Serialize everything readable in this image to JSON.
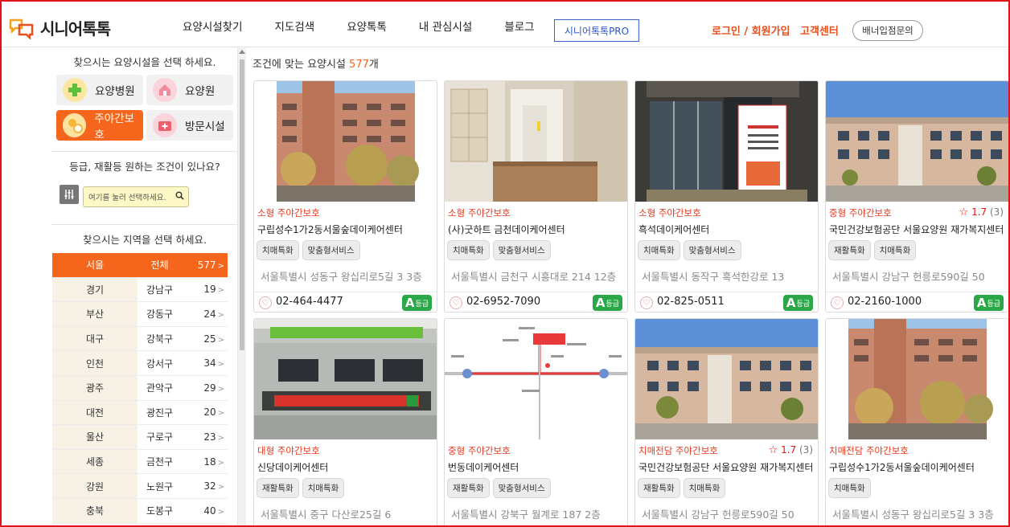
{
  "header": {
    "logo_text": "시니어톡톡",
    "nav": [
      "요양시설찾기",
      "지도검색",
      "요양톡톡",
      "내 관심시설",
      "블로그"
    ],
    "pro_button": "시니어톡톡PRO",
    "login": "로그인 / 회원가입",
    "customer_center": "고객센터",
    "banner_button": "배너입점문의"
  },
  "sidebar": {
    "type_title": "찾으시는 요양시설을 선택 하세요.",
    "types": [
      {
        "label": "요양병원",
        "icon": "plus-icon",
        "color": "#5fbf3a",
        "bg": "#fde7a0"
      },
      {
        "label": "요양원",
        "icon": "house-icon",
        "color": "#f28b9b",
        "bg": "#fbd3da"
      },
      {
        "label": "주야간보호",
        "icon": "sun-moon-icon",
        "color": "#f5b83a",
        "bg": "#fde3a0",
        "active": true
      },
      {
        "label": "방문시설",
        "icon": "medkit-icon",
        "color": "#ef5f6b",
        "bg": "#fbd3da"
      }
    ],
    "condition_title": "등급, 재활등 원하는 조건이 있나요?",
    "condition_placeholder": "여기를 눌러 선택하세요.",
    "region_title": "찾으시는 지역을 선택 하세요.",
    "regions": [
      {
        "city": "서울",
        "district": "전체",
        "count": "577",
        "active": true
      },
      {
        "city": "경기",
        "district": "강남구",
        "count": "19"
      },
      {
        "city": "부산",
        "district": "강동구",
        "count": "24"
      },
      {
        "city": "대구",
        "district": "강북구",
        "count": "25"
      },
      {
        "city": "인천",
        "district": "강서구",
        "count": "34"
      },
      {
        "city": "광주",
        "district": "관악구",
        "count": "29"
      },
      {
        "city": "대전",
        "district": "광진구",
        "count": "20"
      },
      {
        "city": "울산",
        "district": "구로구",
        "count": "23"
      },
      {
        "city": "세종",
        "district": "금천구",
        "count": "18"
      },
      {
        "city": "강원",
        "district": "노원구",
        "count": "32"
      },
      {
        "city": "충북",
        "district": "도봉구",
        "count": "40"
      }
    ],
    "arrow": ">"
  },
  "main": {
    "result_prefix": "조건에 맞는 요양시설",
    "result_count": "577",
    "result_suffix": "개",
    "grade_suffix": "등급",
    "cards": [
      {
        "category": "소형 주야간보호",
        "name": "구립성수1가2동서울숲데이케어센터",
        "tags": [
          "치매특화",
          "맞춤형서비스"
        ],
        "address": "서울특별시 성동구 왕십리로5길 3 3층",
        "phone": "02-464-4477",
        "grade": "A",
        "photo": "building-brick"
      },
      {
        "category": "소형 주야간보호",
        "name": "(사)굿하트 금천데이케어센터",
        "tags": [
          "치매특화",
          "맞춤형서비스"
        ],
        "address": "서울특별시 금천구 시흥대로 214 12층",
        "phone": "02-6952-7090",
        "grade": "A",
        "photo": "interior"
      },
      {
        "category": "소형 주야간보호",
        "name": "흑석데이케어센터",
        "tags": [
          "치매특화",
          "맞춤형서비스"
        ],
        "address": "서울특별시 동작구 흑석한강로 13",
        "phone": "02-825-0511",
        "grade": "A",
        "photo": "entrance"
      },
      {
        "category": "중형 주야간보호",
        "name": "국민건강보험공단 서울요양원 재가복지센터",
        "tags": [
          "재활특화",
          "치매특화"
        ],
        "address": "서울특별시 강남구 헌릉로590길 50",
        "phone": "02-2160-1000",
        "grade": "A",
        "rating": "1.7",
        "rating_count": "(3)",
        "photo": "modern-building"
      },
      {
        "category": "대형 주야간보호",
        "name": "신당데이케어센터",
        "tags": [
          "재활특화",
          "치매특화"
        ],
        "address": "서울특별시 중구 다산로25길 6",
        "photo": "sign-building"
      },
      {
        "category": "중형 주야간보호",
        "name": "번동데이케어센터",
        "tags": [
          "재활특화",
          "맞춤형서비스"
        ],
        "address": "서울특별시 강북구 월계로 187 2층",
        "photo": "map"
      },
      {
        "category": "치매전담 주야간보호",
        "name": "국민건강보험공단 서울요양원 재가복지센터",
        "tags": [
          "재활특화",
          "치매특화"
        ],
        "address": "서울특별시 강남구 헌릉로590길 50",
        "rating": "1.7",
        "rating_count": "(3)",
        "photo": "modern-building"
      },
      {
        "category": "치매전담 주야간보호",
        "name": "구립성수1가2동서울숲데이케어센터",
        "tags": [
          "치매특화"
        ],
        "address": "서울특별시 성동구 왕십리로5길 3 3층",
        "photo": "building-brick"
      }
    ]
  }
}
